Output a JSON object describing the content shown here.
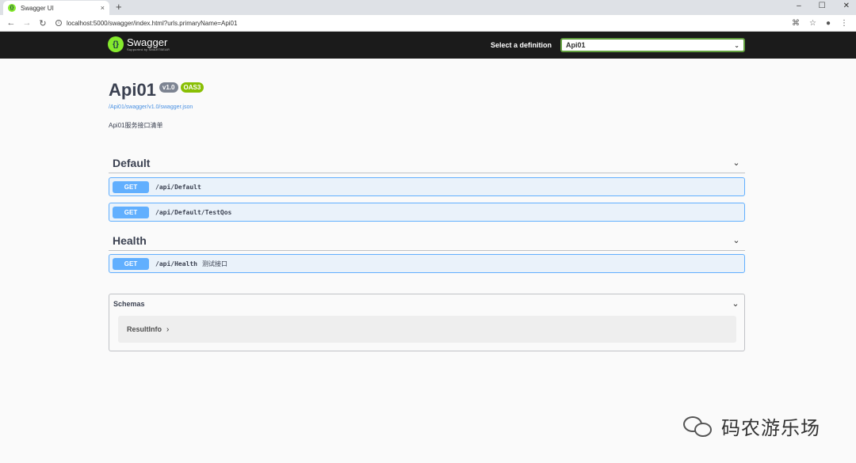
{
  "browser": {
    "tab_title": "Swagger UI",
    "tab_close": "×",
    "new_tab": "+",
    "url": "localhost:5000/swagger/index.html?urls.primaryName=Api01",
    "controls": {
      "minimize": "–",
      "maximize": "☐",
      "close": "✕"
    }
  },
  "topbar": {
    "logo_name": "Swagger",
    "logo_sub": "Supported by SMARTBEAR",
    "definition_label": "Select a definition",
    "definition_value": "Api01",
    "colors": {
      "background": "#1b1b1b",
      "logo": "#85ea2d",
      "select_border": "#62a03f"
    }
  },
  "info": {
    "title": "Api01",
    "version": "v1.0",
    "oas": "OAS3",
    "spec_url": "/Api01/swagger/v1.0/swagger.json",
    "description": "Api01服务接口清单"
  },
  "groups": [
    {
      "name": "Default",
      "operations": [
        {
          "method": "GET",
          "path": "/api/Default",
          "summary": ""
        },
        {
          "method": "GET",
          "path": "/api/Default/TestQos",
          "summary": ""
        }
      ]
    },
    {
      "name": "Health",
      "operations": [
        {
          "method": "GET",
          "path": "/api/Health",
          "summary": "测试接口"
        }
      ]
    }
  ],
  "schemas": {
    "title": "Schemas",
    "models": [
      "ResultInfo"
    ]
  },
  "watermark": {
    "text": "码农游乐场",
    "icon": "wechat-icon"
  },
  "icons": {
    "chevron_down": "⌄",
    "chevron_right": "›"
  }
}
